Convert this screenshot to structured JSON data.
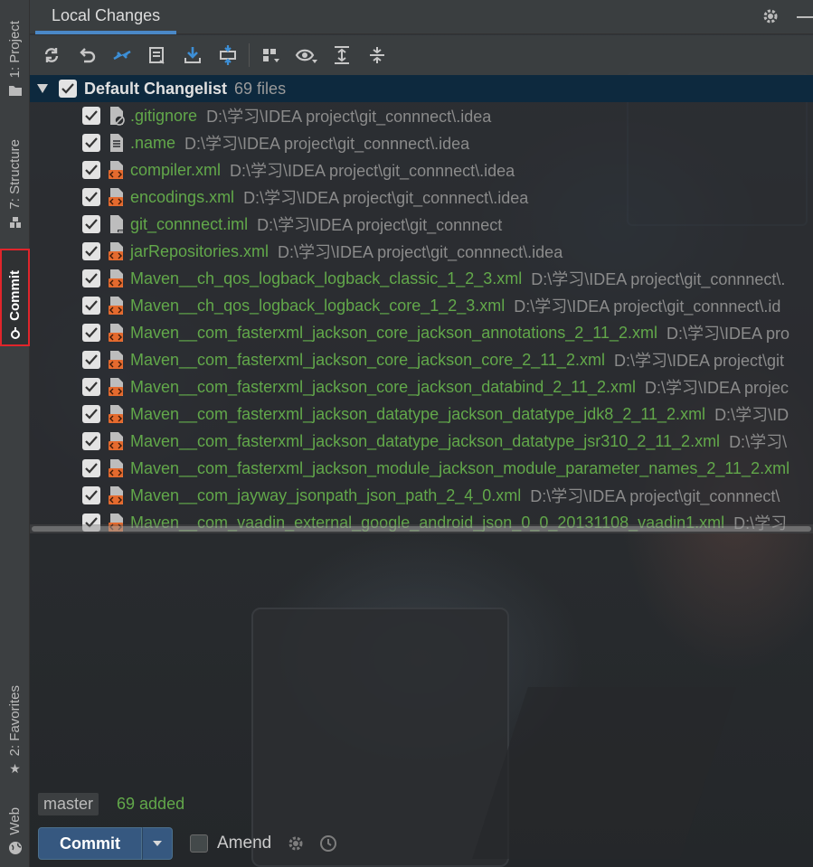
{
  "tool_strip": {
    "project": "1: Project",
    "structure": "7: Structure",
    "commit": "Commit",
    "favorites": "2: Favorites",
    "web": "Web"
  },
  "header": {
    "tab": "Local Changes"
  },
  "toolbar": {
    "buttons": [
      {
        "name": "refresh-icon"
      },
      {
        "name": "rollback-icon"
      },
      {
        "name": "show-diff-icon"
      },
      {
        "name": "shelve-icon"
      },
      {
        "name": "update-icon"
      },
      {
        "name": "move-changes-icon"
      },
      {
        "name": "group-by-icon"
      },
      {
        "name": "view-options-icon"
      },
      {
        "name": "expand-all-icon"
      },
      {
        "name": "collapse-all-icon"
      }
    ]
  },
  "changelist": {
    "name": "Default Changelist",
    "count": "69 files",
    "files": [
      {
        "name": ".gitignore",
        "path": "D:\\学习\\IDEA project\\git_connnect\\.idea",
        "icon": "ignore"
      },
      {
        "name": ".name",
        "path": "D:\\学习\\IDEA project\\git_connnect\\.idea",
        "icon": "text"
      },
      {
        "name": "compiler.xml",
        "path": "D:\\学习\\IDEA project\\git_connnect\\.idea",
        "icon": "xml"
      },
      {
        "name": "encodings.xml",
        "path": "D:\\学习\\IDEA project\\git_connnect\\.idea",
        "icon": "xml"
      },
      {
        "name": "git_connnect.iml",
        "path": "D:\\学习\\IDEA project\\git_connnect",
        "icon": "iml"
      },
      {
        "name": "jarRepositories.xml",
        "path": "D:\\学习\\IDEA project\\git_connnect\\.idea",
        "icon": "xml"
      },
      {
        "name": "Maven__ch_qos_logback_logback_classic_1_2_3.xml",
        "path": "D:\\学习\\IDEA project\\git_connnect\\.",
        "icon": "xml"
      },
      {
        "name": "Maven__ch_qos_logback_logback_core_1_2_3.xml",
        "path": "D:\\学习\\IDEA project\\git_connnect\\.id",
        "icon": "xml"
      },
      {
        "name": "Maven__com_fasterxml_jackson_core_jackson_annotations_2_11_2.xml",
        "path": "D:\\学习\\IDEA pro",
        "icon": "xml"
      },
      {
        "name": "Maven__com_fasterxml_jackson_core_jackson_core_2_11_2.xml",
        "path": "D:\\学习\\IDEA project\\git",
        "icon": "xml"
      },
      {
        "name": "Maven__com_fasterxml_jackson_core_jackson_databind_2_11_2.xml",
        "path": "D:\\学习\\IDEA projec",
        "icon": "xml"
      },
      {
        "name": "Maven__com_fasterxml_jackson_datatype_jackson_datatype_jdk8_2_11_2.xml",
        "path": "D:\\学习\\ID",
        "icon": "xml"
      },
      {
        "name": "Maven__com_fasterxml_jackson_datatype_jackson_datatype_jsr310_2_11_2.xml",
        "path": "D:\\学习\\",
        "icon": "xml"
      },
      {
        "name": "Maven__com_fasterxml_jackson_module_jackson_module_parameter_names_2_11_2.xml",
        "path": "",
        "icon": "xml"
      },
      {
        "name": "Maven__com_jayway_jsonpath_json_path_2_4_0.xml",
        "path": "D:\\学习\\IDEA project\\git_connnect\\",
        "icon": "xml"
      },
      {
        "name": "Maven__com_vaadin_external_google_android_json_0_0_20131108_vaadin1.xml",
        "path": "D:\\学习",
        "icon": "xml"
      }
    ]
  },
  "status": {
    "branch": "master",
    "summary": "69 added"
  },
  "commit": {
    "button": "Commit",
    "amend": "Amend"
  },
  "colors": {
    "accent": "#4a88c7",
    "added_green": "#62a84a",
    "commit_button": "#365880",
    "highlight_border": "#e0252b"
  }
}
